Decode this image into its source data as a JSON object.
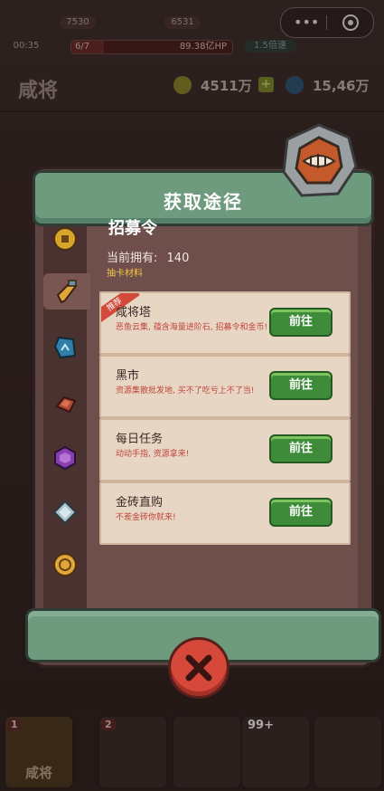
{
  "game": {
    "top": {
      "level_badge": "7530",
      "stage_badge": "6531",
      "timer": "00:35",
      "wave": "6/7",
      "boss_hp": "89.38亿HP",
      "speed": "1.5倍速"
    },
    "header": {
      "title": "咸将",
      "currency1": "4511万",
      "currency2": "15,46万"
    },
    "bottom_nav": [
      {
        "label": "咸将",
        "badge": "1"
      },
      {
        "label": "",
        "badge": "2"
      },
      {
        "label": "",
        "badge": ""
      },
      {
        "label": "",
        "badge": "99+"
      },
      {
        "label": "",
        "badge": ""
      }
    ]
  },
  "dialog": {
    "title": "获取途径",
    "item_name": "招募令",
    "owned_label": "当前拥有:",
    "owned_count": "140",
    "item_desc": "抽卡材料",
    "sources": [
      {
        "name": "咸将塔",
        "desc": "恶鱼云集, 蕴含海量进阶石, 招募令和金币!",
        "button": "前往",
        "tag": "推荐"
      },
      {
        "name": "黑市",
        "desc": "资源集散批发地, 买不了吃亏上不了当!",
        "button": "前往",
        "tag": ""
      },
      {
        "name": "每日任务",
        "desc": "动动手指, 资源拿来!",
        "button": "前往",
        "tag": ""
      },
      {
        "name": "金砖直购",
        "desc": "不差金砖你就来!",
        "button": "前往",
        "tag": ""
      }
    ],
    "side_tabs": [
      "coin-icon",
      "recruit-token-icon",
      "advance-stone-icon",
      "brick-icon",
      "purple-gem-icon",
      "silver-crystal-icon",
      "gold-medal-icon"
    ],
    "selected_tab": 1
  },
  "colors": {
    "ribbon": "#6e9a7e",
    "go_button": "#3e8c3a",
    "close_button": "#d6483a",
    "desc_red": "#c0453c",
    "desc_gold": "#f3c24a"
  }
}
